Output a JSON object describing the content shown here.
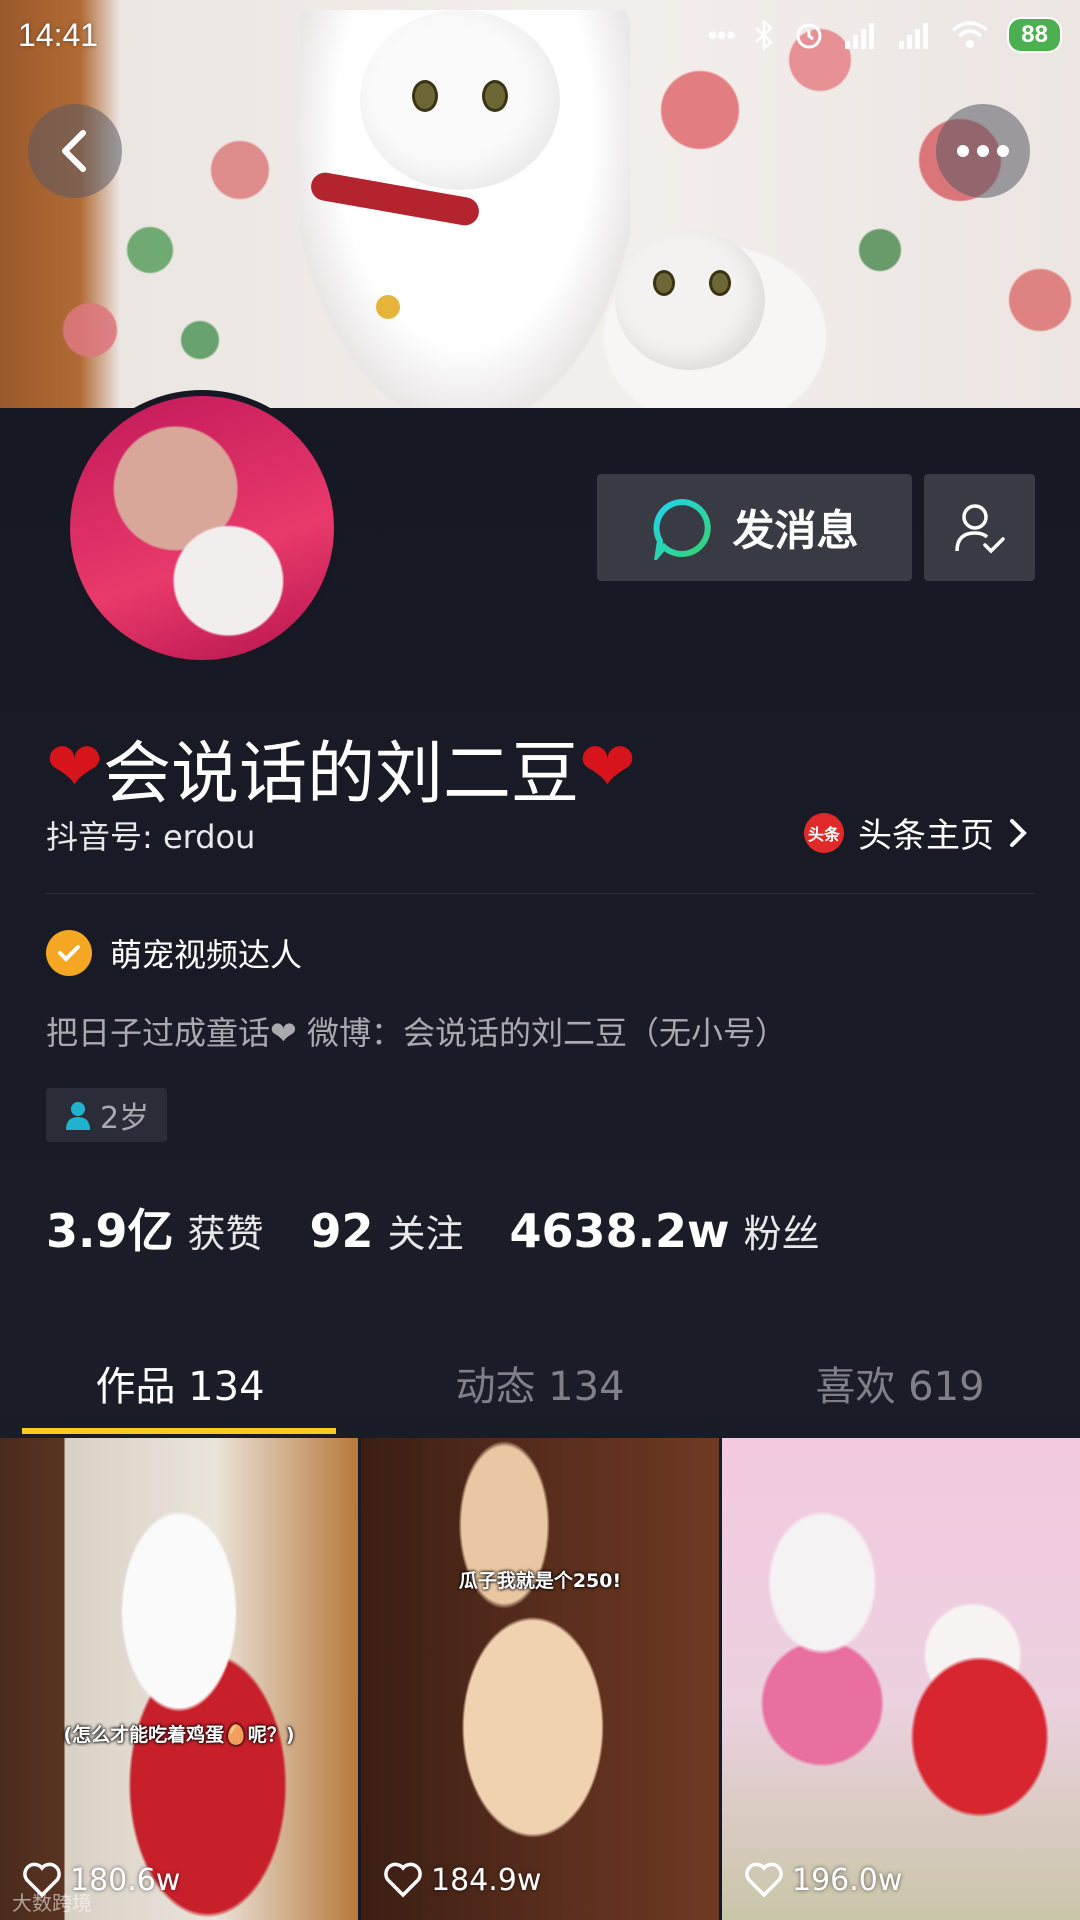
{
  "status_bar": {
    "time": "14:41",
    "battery": "88"
  },
  "profile": {
    "name": "会说话的刘二豆",
    "name_heart": "❤",
    "douyin_id": "抖音号: erdou",
    "toutiao_label": "头条主页",
    "toutiao_logo": "头条",
    "verified_label": "萌宠视频达人",
    "bio": "把日子过成童话❤ 微博：会说话的刘二豆（无小号）",
    "age": "2岁"
  },
  "actions": {
    "message_label": "发消息"
  },
  "stats": [
    {
      "value": "3.9亿",
      "label": "获赞"
    },
    {
      "value": "92",
      "label": "关注"
    },
    {
      "value": "4638.2w",
      "label": "粉丝"
    }
  ],
  "tabs": [
    {
      "label": "作品 134"
    },
    {
      "label": "动态 134"
    },
    {
      "label": "喜欢 619"
    }
  ],
  "videos": [
    {
      "caption": "(怎么才能吃着鸡蛋🥚呢？)",
      "likes": "180.6w"
    },
    {
      "caption": "瓜子我就是个250!",
      "likes": "184.9w"
    },
    {
      "caption": "",
      "likes": "196.0w"
    }
  ],
  "watermark": "大数跨境",
  "colors": {
    "background": "#161823",
    "tab_indicator": "#facb1c",
    "verified_badge": "#f5a623",
    "heart": "#d7141c"
  }
}
